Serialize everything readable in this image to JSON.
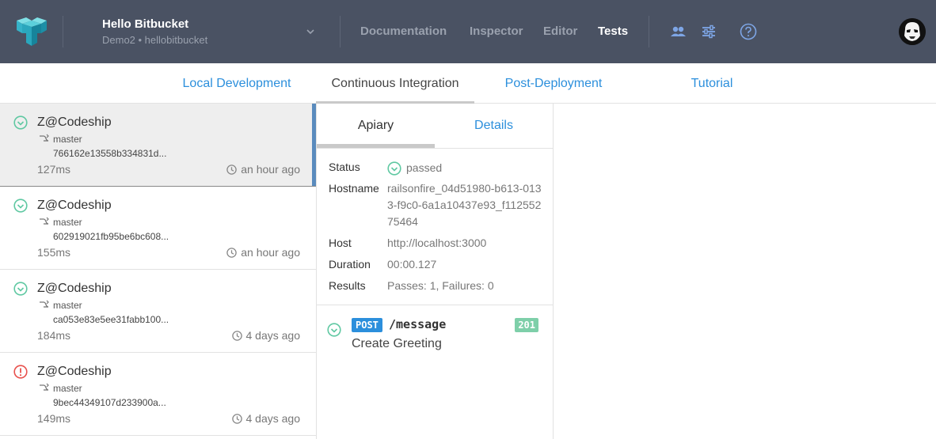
{
  "header": {
    "project_title": "Hello Bitbucket",
    "project_subtitle": "Demo2 • hellobitbucket",
    "nav": [
      "Documentation",
      "Inspector",
      "Editor",
      "Tests"
    ],
    "active_nav": "Tests"
  },
  "subnav": {
    "tabs": [
      "Local Development",
      "Continuous Integration",
      "Post-Deployment",
      "Tutorial"
    ],
    "active": "Continuous Integration"
  },
  "runs": [
    {
      "status": "passed",
      "name": "Z@Codeship",
      "branch": "master",
      "hash": "766162e13558b334831d...",
      "duration": "127ms",
      "time": "an hour ago"
    },
    {
      "status": "passed",
      "name": "Z@Codeship",
      "branch": "master",
      "hash": "602919021fb95be6bc608...",
      "duration": "155ms",
      "time": "an hour ago"
    },
    {
      "status": "passed",
      "name": "Z@Codeship",
      "branch": "master",
      "hash": "ca053e83e5ee31fabb100...",
      "duration": "184ms",
      "time": "4 days ago"
    },
    {
      "status": "failed",
      "name": "Z@Codeship",
      "branch": "master",
      "hash": "9bec44349107d233900a...",
      "duration": "149ms",
      "time": "4 days ago"
    }
  ],
  "detail": {
    "tabs": [
      "Apiary",
      "Details"
    ],
    "active_tab": "Apiary",
    "fields": {
      "status_label": "Status",
      "status_value": "passed",
      "hostname_label": "Hostname",
      "hostname_value": "railsonfire_04d51980-b613-0133-f9c0-6a1a10437e93_f11255275464",
      "host_label": "Host",
      "host_value": "http://localhost:3000",
      "duration_label": "Duration",
      "duration_value": "00:00.127",
      "results_label": "Results",
      "results_value": "Passes: 1, Failures: 0"
    },
    "endpoint": {
      "method": "POST",
      "path": "/message",
      "code": "201",
      "name": "Create Greeting"
    }
  },
  "colors": {
    "topbar": "#4a5263",
    "link": "#2c8fdc",
    "passed": "#5fc8a2",
    "failed": "#e8504c",
    "code_badge": "#7ecfa9"
  }
}
